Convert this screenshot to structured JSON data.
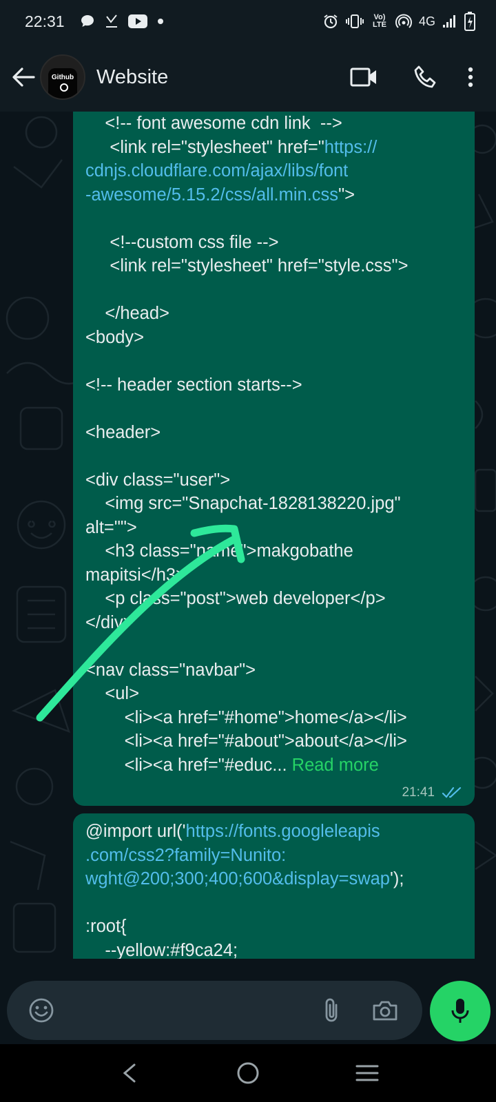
{
  "status_bar": {
    "time": "22:31",
    "network": "4G",
    "volte": "Vo) LTE",
    "left_icons": [
      "chat-bubble-icon",
      "download-icon",
      "youtube-icon",
      "dot-icon"
    ],
    "right_icons": [
      "alarm-icon",
      "vibrate-icon",
      "volte-icon",
      "hotspot-icon",
      "signal-icon",
      "battery-icon"
    ]
  },
  "header": {
    "title": "Website",
    "avatar_text": "Github"
  },
  "messages": [
    {
      "lines": [
        "    <!-- font awesome cdn link  -->",
        "     <link rel=\"stylesheet\" href=\"",
        "cdnjs.cloudflare.com/ajax/libs/font",
        "-awesome/5.15.2/css/all.min.css",
        "",
        "     <!--custom css file -->",
        "     <link rel=\"stylesheet\" href=\"style.css\">",
        "",
        "    </head>",
        "<body>",
        "",
        "<!-- header section starts-->",
        "",
        "<header>",
        "",
        "<div class=\"user\">",
        "    <img src=\"Snapchat-1828138220.jpg\"",
        "alt=\"\">",
        "    <h3 class=\"name\">makgobathe",
        "mapitsi</h3>",
        "    <p class=\"post\">web developer</p>",
        "</div>",
        "",
        "<nav class=\"navbar\">",
        "    <ul>",
        "        <li><a href=\"#home\">home</a></li>",
        "        <li><a href=\"#about\">about</a></li>",
        "        <li><a href=\"#educ... "
      ],
      "link_parts": [
        "https://",
        "\">"
      ],
      "read_more": "Read more",
      "time": "21:41",
      "status": "read"
    },
    {
      "line1_prefix": "@import url('",
      "line1_link": "https://fonts.googleleapis",
      "line2_link": ".com/css2?family=Nunito:",
      "line3_link": "wght@200;300;400;600&display=swap",
      "line3_suffix": "');",
      "line4": "",
      "line5": ":root{",
      "line6": "    --yellow:#f9ca24;"
    }
  ],
  "input": {
    "placeholder": ""
  },
  "colors": {
    "outgoing_bubble": "#005c4b",
    "link": "#53bdeb",
    "read_more": "#25d366",
    "mic_button": "#25d366",
    "annotation_arrow": "#2ee89a"
  }
}
